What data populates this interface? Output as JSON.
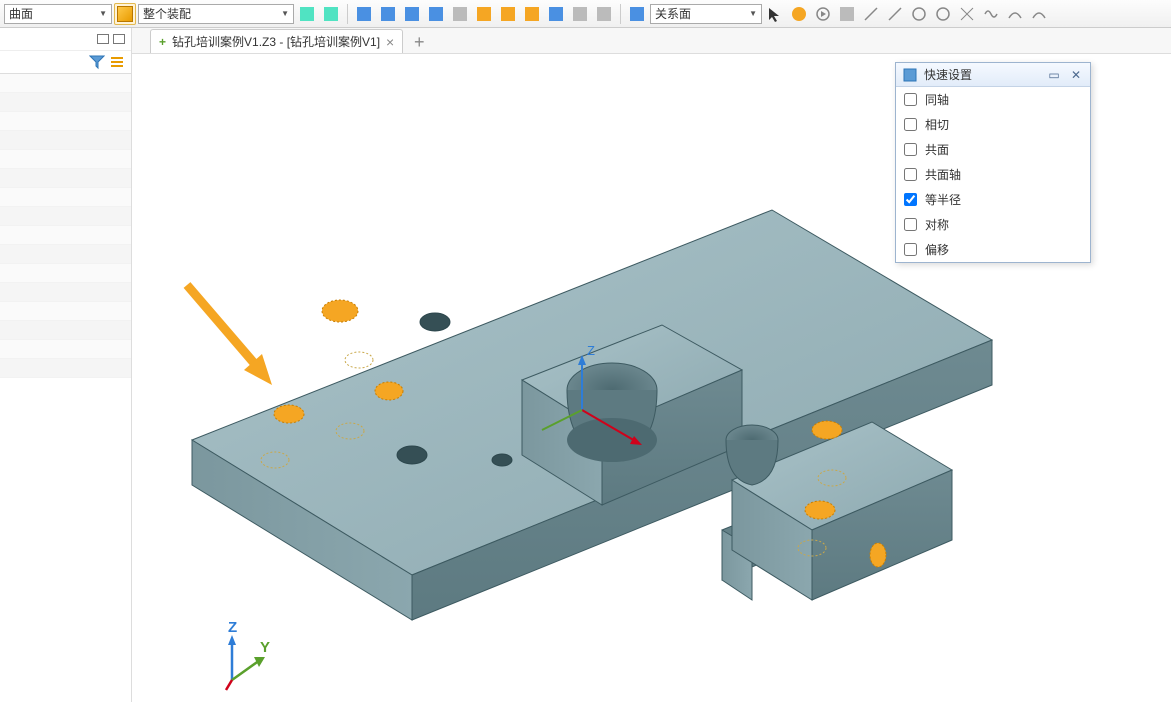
{
  "toolbar": {
    "dropdown1": "曲面",
    "dropdown2": "整个装配",
    "dropdown3": "关系面"
  },
  "tab": {
    "plus": "+",
    "label": "钻孔培训案例V1.Z3 - [钻孔培训案例V1]",
    "close": "×"
  },
  "axes": {
    "z": "Z",
    "y": "Y"
  },
  "miniaxes": {
    "z": "Z"
  },
  "qpanel": {
    "title": "快速设置",
    "items": [
      {
        "label": "同轴",
        "checked": false
      },
      {
        "label": "相切",
        "checked": false
      },
      {
        "label": "共面",
        "checked": false
      },
      {
        "label": "共面轴",
        "checked": false
      },
      {
        "label": "等半径",
        "checked": true
      },
      {
        "label": "对称",
        "checked": false
      },
      {
        "label": "偏移",
        "checked": false
      }
    ]
  }
}
